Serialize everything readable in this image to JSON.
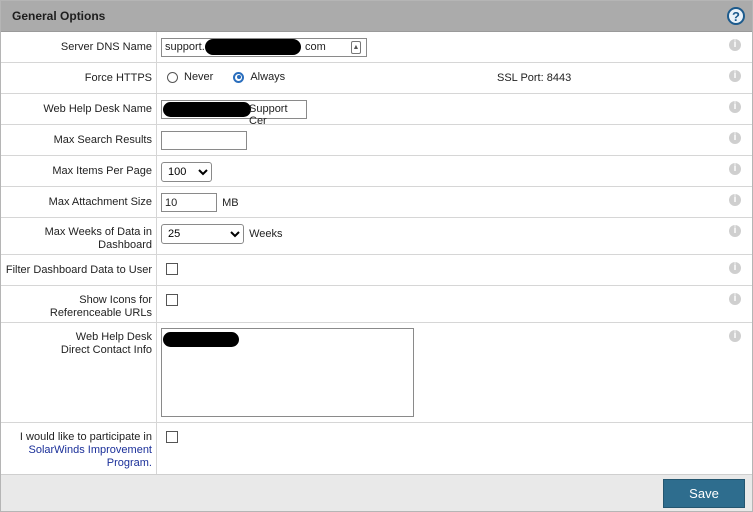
{
  "panel": {
    "title": "General Options",
    "help_glyph": "?"
  },
  "fields": {
    "server_dns": {
      "label": "Server DNS Name",
      "value_prefix": "support.",
      "value_suffix": "com"
    },
    "force_https": {
      "label": "Force HTTPS",
      "options": [
        "Never",
        "Always"
      ],
      "selected": "Always",
      "ssl_port_text": "SSL Port: 8443"
    },
    "web_help_desk_name": {
      "label": "Web Help Desk Name",
      "value_suffix": "Support Cer"
    },
    "max_search_results": {
      "label": "Max Search Results",
      "value": ""
    },
    "max_items_per_page": {
      "label": "Max Items Per Page",
      "value": "100"
    },
    "max_attachment_size": {
      "label": "Max Attachment Size",
      "value": "10",
      "unit": "MB"
    },
    "max_weeks_dashboard": {
      "label": "Max Weeks of Data in Dashboard",
      "value": "25",
      "unit": "Weeks"
    },
    "filter_dashboard": {
      "label": "Filter Dashboard Data to User",
      "checked": false
    },
    "show_icons": {
      "label": "Show Icons for Referenceable URLs",
      "checked": false
    },
    "direct_contact": {
      "label_line1": "Web Help Desk",
      "label_line2": "Direct Contact Info"
    },
    "improvement": {
      "label_prefix": "I would like to participate in",
      "link_text": "SolarWinds Improvement Program.",
      "checked": false
    }
  },
  "footer": {
    "save_label": "Save"
  },
  "icons": {
    "info": "info-icon",
    "help": "help-icon",
    "key": "key-icon"
  },
  "colors": {
    "header_bg": "#ababab",
    "save_bg": "#2e6d8e",
    "radio_accent": "#2a6ebd",
    "link": "#1a2f99"
  }
}
